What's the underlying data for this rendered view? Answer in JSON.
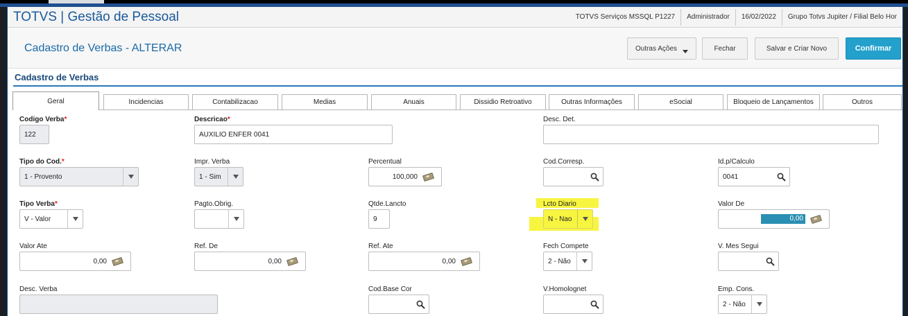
{
  "app": {
    "title": "TOTVS | Gestão de Pessoal",
    "status": [
      "TOTVS Serviços MSSQL P1227",
      "Administrador",
      "16/02/2022",
      "Grupo Totvs Jupiter / Filial Belo Hor"
    ]
  },
  "header": {
    "title": "Cadastro de Verbas - ALTERAR",
    "buttons": {
      "outras_acoes": "Outras Ações",
      "fechar": "Fechar",
      "salvar_criar": "Salvar e Criar Novo",
      "confirmar": "Confirmar"
    }
  },
  "section": {
    "title": "Cadastro de Verbas"
  },
  "tabs": [
    "Geral",
    "Incidencias",
    "Contabilizacao",
    "Medias",
    "Anuais",
    "Dissidio Retroativo",
    "Outras Informações",
    "eSocial",
    "Bloqueio de Lançamentos",
    "Outros"
  ],
  "fields": {
    "codigo_verba": {
      "label": "Codigo Verba",
      "value": "122"
    },
    "descricao": {
      "label": "Descricao",
      "value": "AUXILIO ENFER 0041"
    },
    "desc_det": {
      "label": "Desc. Det.",
      "value": ""
    },
    "tipo_cod": {
      "label": "Tipo do Cod.",
      "value": "1 - Provento"
    },
    "impr_verba": {
      "label": "Impr. Verba",
      "value": "1 - Sim"
    },
    "percentual": {
      "label": "Percentual",
      "value": "100,000"
    },
    "cod_corresp": {
      "label": "Cod.Corresp.",
      "value": ""
    },
    "id_calculo": {
      "label": "Id.p/Calculo",
      "value": "0041"
    },
    "tipo_verba": {
      "label": "Tipo Verba",
      "value": "V - Valor"
    },
    "pagto_obrig": {
      "label": "Pagto.Obrig.",
      "value": ""
    },
    "qtde_lancto": {
      "label": "Qtde.Lancto",
      "value": "9"
    },
    "lcto_diario": {
      "label": "Lcto Diario",
      "value": "N - Nao"
    },
    "valor_de": {
      "label": "Valor De",
      "value": "0,00"
    },
    "valor_ate": {
      "label": "Valor Ate",
      "value": "0,00"
    },
    "ref_de": {
      "label": "Ref. De",
      "value": "0,00"
    },
    "ref_ate": {
      "label": "Ref. Ate",
      "value": "0,00"
    },
    "fech_compete": {
      "label": "Fech Compete",
      "value": "2 - Não"
    },
    "v_mes_segui": {
      "label": "V. Mes Segui",
      "value": ""
    },
    "desc_verba": {
      "label": "Desc. Verba",
      "value": ""
    },
    "cod_base_cor": {
      "label": "Cod.Base Cor",
      "value": ""
    },
    "v_homolognet": {
      "label": "V.Homolognet",
      "value": ""
    },
    "emp_cons": {
      "label": "Emp. Cons.",
      "value": "2 - Não"
    }
  },
  "colors": {
    "accent": "#23a0cc",
    "title_blue": "#1a5a9a",
    "highlight": "#f7f540",
    "required": "#e02020"
  },
  "icons": [
    "search-icon",
    "money-icon",
    "chevron-down-icon"
  ]
}
